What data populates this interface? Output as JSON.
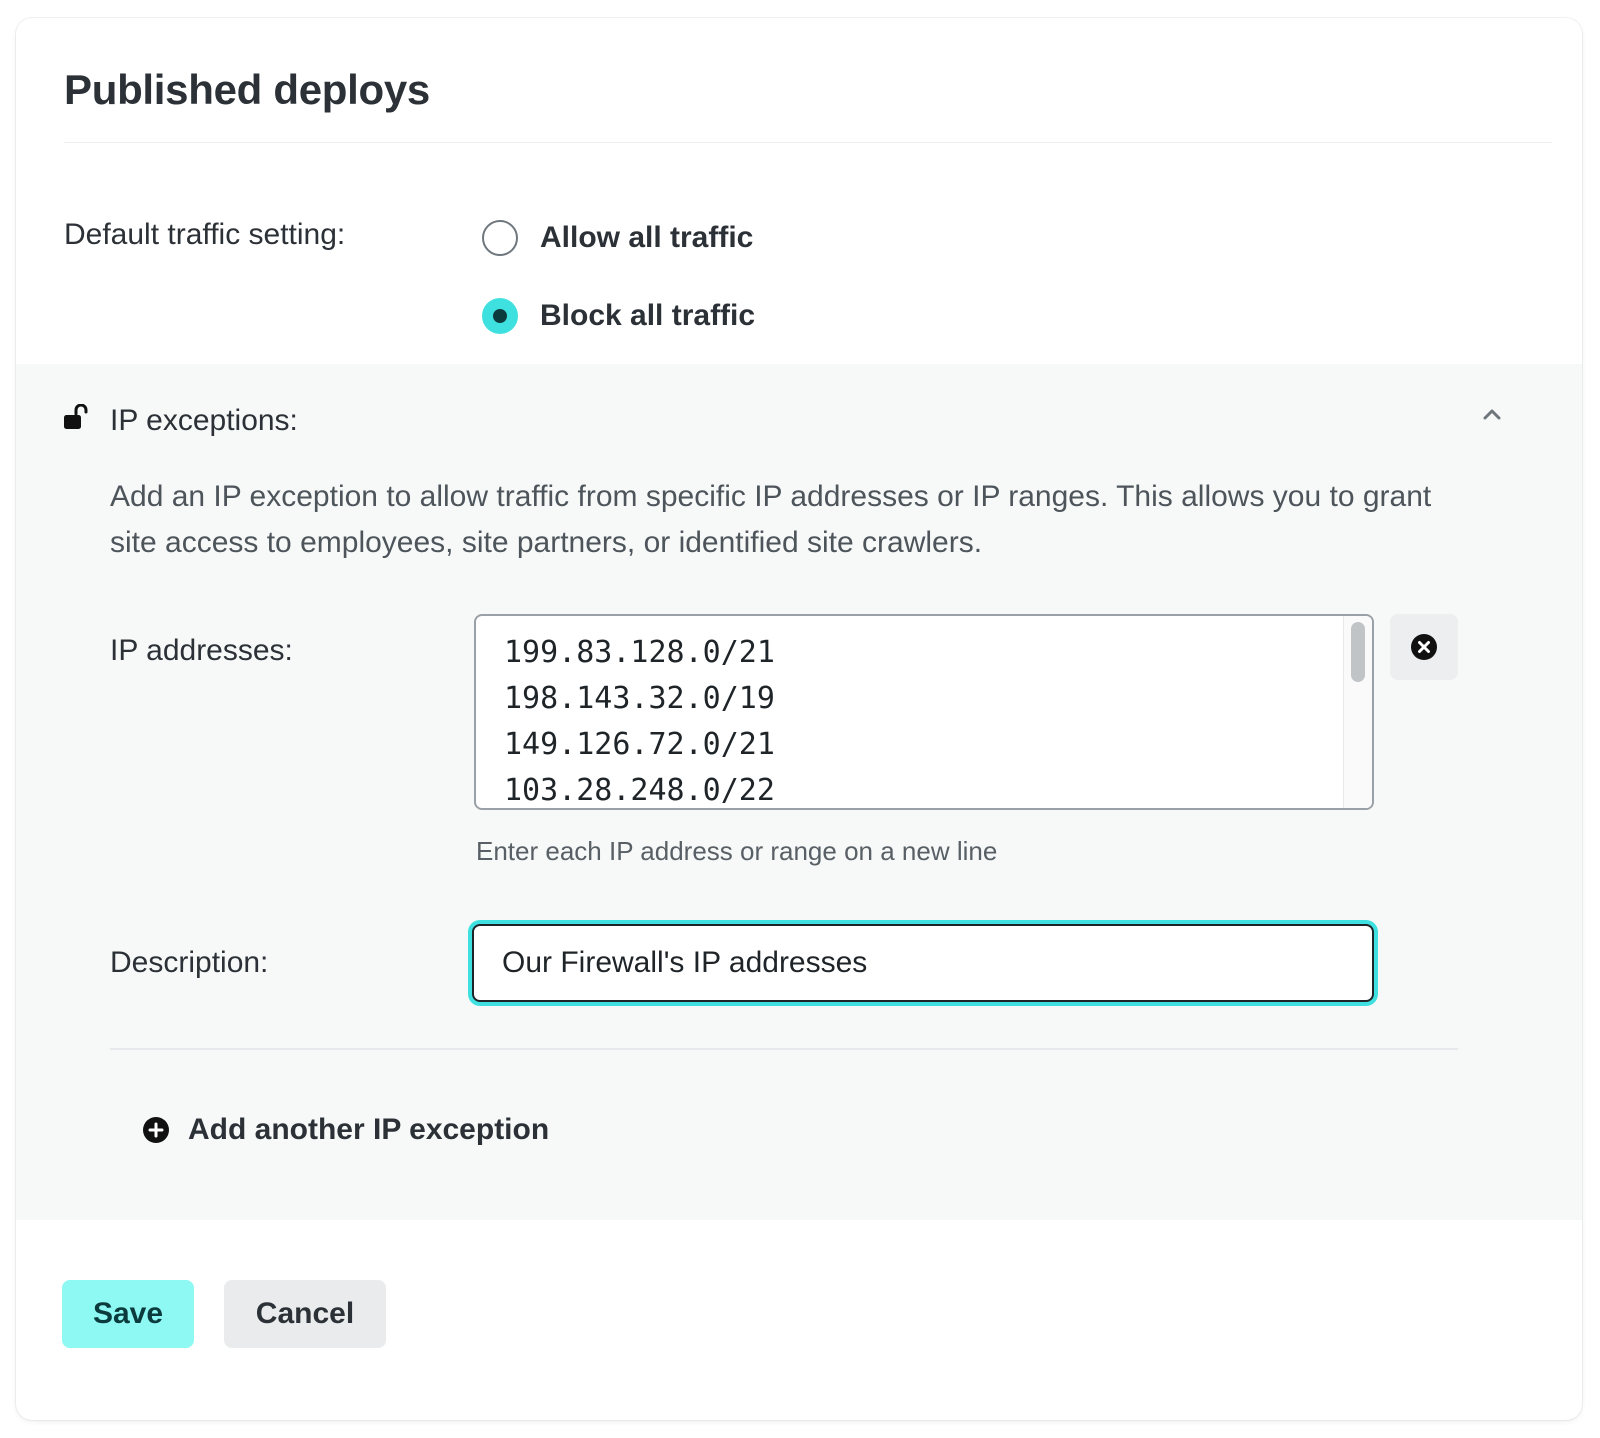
{
  "header": {
    "title": "Published deploys"
  },
  "traffic": {
    "label": "Default traffic setting:",
    "options": [
      {
        "label": "Allow all traffic",
        "checked": false
      },
      {
        "label": "Block all traffic",
        "checked": true
      }
    ]
  },
  "exceptions": {
    "label": "IP exceptions:",
    "icon": "unlocked-padlock-icon",
    "expanded": true,
    "description": "Add an IP exception to allow traffic from specific IP addresses or IP ranges. This allows you to grant site access to employees, site partners, or identified site crawlers.",
    "ip_label": "IP addresses:",
    "ip_addresses": [
      "199.83.128.0/21",
      "198.143.32.0/19",
      "149.126.72.0/21",
      "103.28.248.0/22"
    ],
    "ip_hint": "Enter each IP address or range on a new line",
    "description_label": "Description:",
    "description_value": "Our Firewall's IP addresses",
    "add_label": "Add another IP exception"
  },
  "actions": {
    "save_label": "Save",
    "cancel_label": "Cancel"
  },
  "colors": {
    "accent": "#3ee0e0",
    "save_button": "#8ef8f3",
    "text": "#2b3136",
    "panel_background": "#f7f9f9"
  }
}
